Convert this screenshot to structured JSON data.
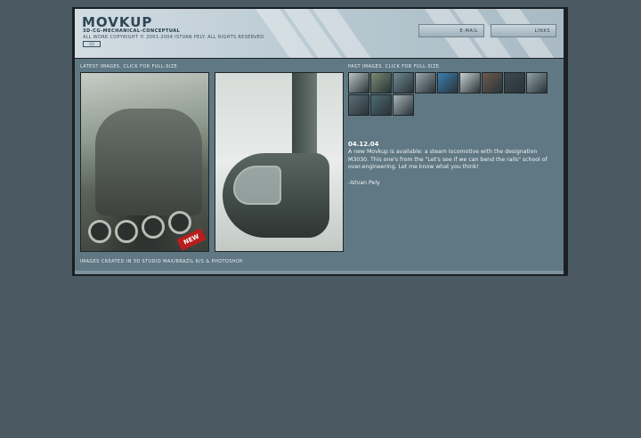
{
  "header": {
    "logo": "MOVKUP",
    "tagline": "3D-CG-MECHANICAL-CONCEPTUAL",
    "copyright": "ALL WORK COPYRIGHT © 2001-2004 ISTVAN PELY. ALL RIGHTS RESERVED.",
    "badge": "V3",
    "email_label": "E-MAIL",
    "links_label": "LINKS"
  },
  "latest": {
    "label": "LATEST IMAGES. CLICK FOR FULL-SIZE.",
    "new_tag": "NEW"
  },
  "past": {
    "label": "PAST IMAGES. CLICK FOR FULL-SIZE.",
    "thumb_colors": [
      "#b9c3c4",
      "#7a8b73",
      "#6e8a92",
      "#9aa7ad",
      "#3a7fb3",
      "#c9d0d1",
      "#6d5a4d",
      "#3c4a52",
      "#8fa2a9",
      "#5b6e76",
      "#4d6a72",
      "#a7b3b8"
    ]
  },
  "news": {
    "date": "04.12.04",
    "text": "A new Movkup is available: a steam locomotive with the designation M3030. This one's from the \"Let's see if we can bend the rails\" school of over-engineering. Let me know what you think!",
    "signature": "-Istvan Pely"
  },
  "footer": {
    "credits": "IMAGES CREATED IN 3D STUDIO MAX/BRAZIL R/S & PHOTOSHOP."
  }
}
